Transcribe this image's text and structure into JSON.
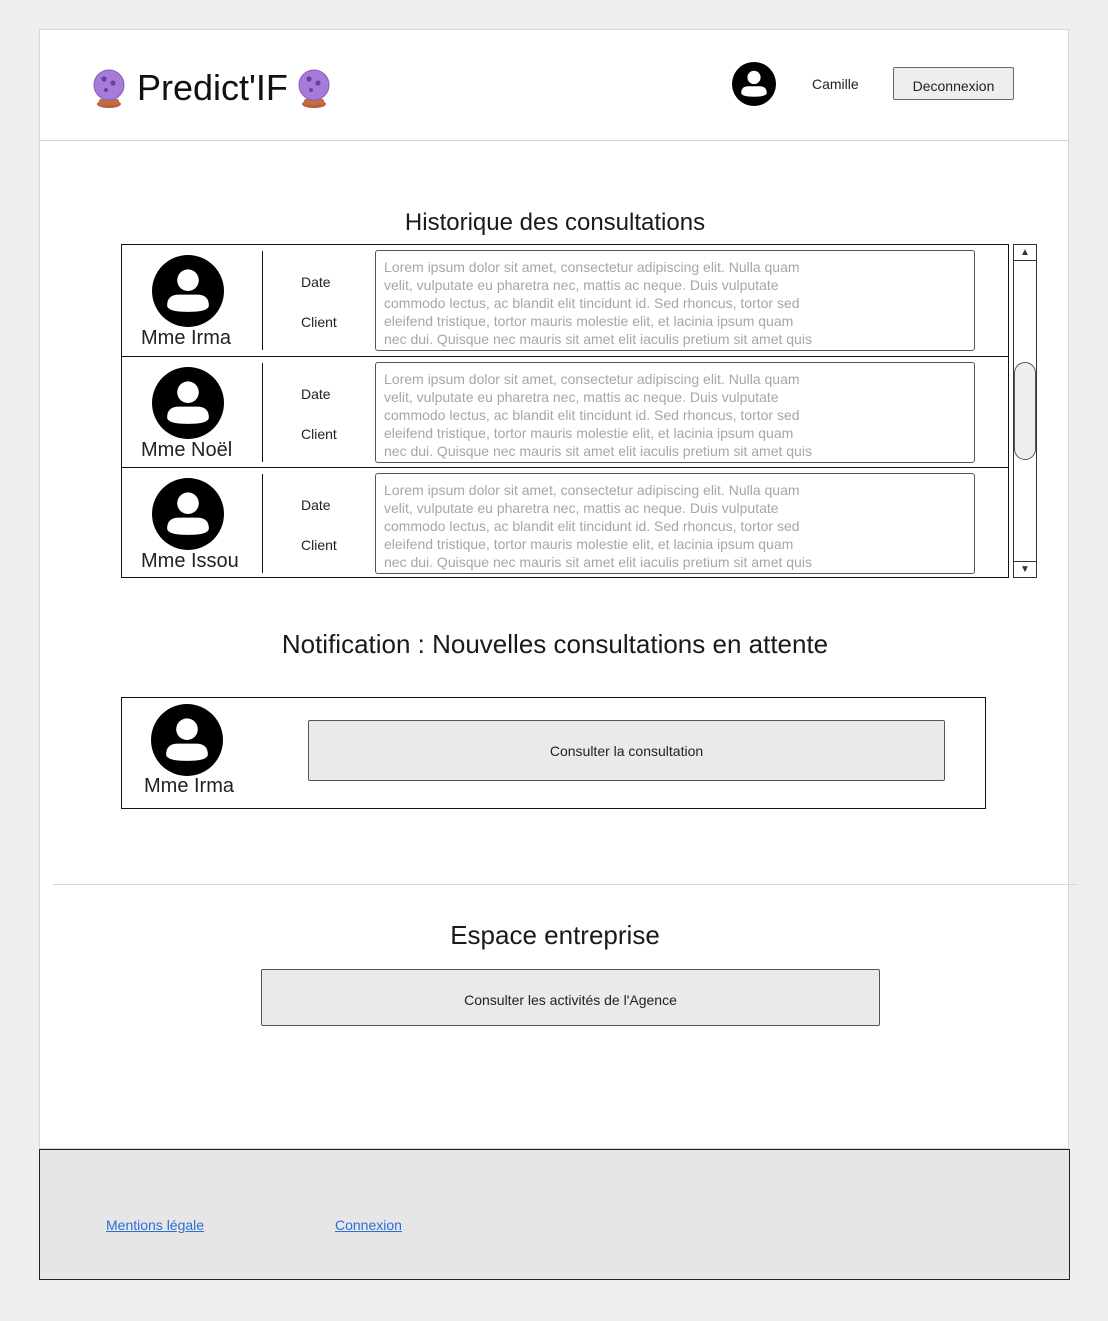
{
  "header": {
    "brand_title": "Predict'IF",
    "user_name": "Camille",
    "logout_label": "Deconnexion"
  },
  "history": {
    "title": "Historique des consultations",
    "date_label": "Date",
    "client_label": "Client",
    "items": [
      {
        "medium": "Mme Irma",
        "summary": "Lorem ipsum dolor sit amet, consectetur adipiscing elit. Nulla quam\nvelit, vulputate eu pharetra nec, mattis ac neque. Duis vulputate\ncommodo lectus, ac blandit elit tincidunt id. Sed rhoncus, tortor sed\neleifend tristique, tortor mauris molestie elit, et lacinia ipsum quam\nnec dui. Quisque nec mauris sit amet elit iaculis pretium sit amet quis"
      },
      {
        "medium": "Mme Noël",
        "summary": "Lorem ipsum dolor sit amet, consectetur adipiscing elit. Nulla quam\nvelit, vulputate eu pharetra nec, mattis ac neque. Duis vulputate\ncommodo lectus, ac blandit elit tincidunt id. Sed rhoncus, tortor sed\neleifend tristique, tortor mauris molestie elit, et lacinia ipsum quam\nnec dui. Quisque nec mauris sit amet elit iaculis pretium sit amet quis"
      },
      {
        "medium": "Mme Issou",
        "summary": "Lorem ipsum dolor sit amet, consectetur adipiscing elit. Nulla quam\nvelit, vulputate eu pharetra nec, mattis ac neque. Duis vulputate\ncommodo lectus, ac blandit elit tincidunt id. Sed rhoncus, tortor sed\neleifend tristique, tortor mauris molestie elit, et lacinia ipsum quam\nnec dui. Quisque nec mauris sit amet elit iaculis pretium sit amet quis"
      }
    ]
  },
  "notification": {
    "title": "Notification : Nouvelles consultations en attente",
    "medium": "Mme Irma",
    "button_label": "Consulter la consultation"
  },
  "enterprise": {
    "title": "Espace entreprise",
    "button_label": "Consulter les activités de l'Agence"
  },
  "footer": {
    "legal_link": "Mentions légale",
    "login_link": "Connexion"
  },
  "icons": {
    "brand": "crystal-ball-icon",
    "user": "user-circle-icon",
    "scroll_up": "arrow-up-icon",
    "scroll_down": "arrow-down-icon"
  },
  "colors": {
    "page_background": "#eeeeee",
    "footer_background": "#e6e6e6",
    "link": "#2a6fd6",
    "placeholder_text": "#a6a6a6",
    "orb": "#9b6fd1"
  }
}
